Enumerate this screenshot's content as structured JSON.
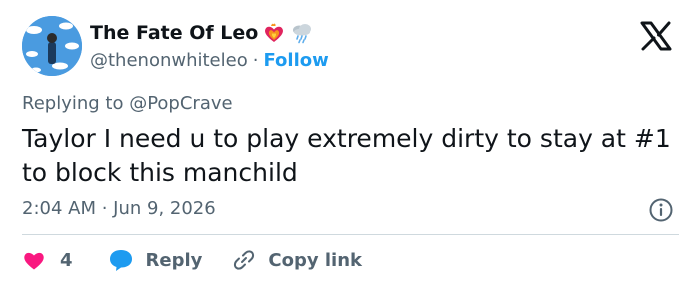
{
  "author": {
    "display_name": "The Fate Of Leo",
    "handle": "@thenonwhiteleo",
    "separator": "·",
    "follow_label": "Follow",
    "badge_icons": [
      "flaming-heart-icon",
      "cloud-rain-icon"
    ]
  },
  "reply_context": {
    "prefix": "Replying to ",
    "mention": "@PopCrave"
  },
  "tweet": {
    "text": "Taylor I need u to play extremely dirty to stay at #1 to block this manchild",
    "timestamp": "2:04 AM · Jun 9, 2026"
  },
  "actions": {
    "like_count": "4",
    "reply_label": "Reply",
    "copy_label": "Copy link"
  },
  "colors": {
    "accent": "#1d9bf0",
    "heart": "#f91880",
    "text": "#0f1419",
    "secondary": "#536471",
    "divider": "#cfd9de"
  }
}
